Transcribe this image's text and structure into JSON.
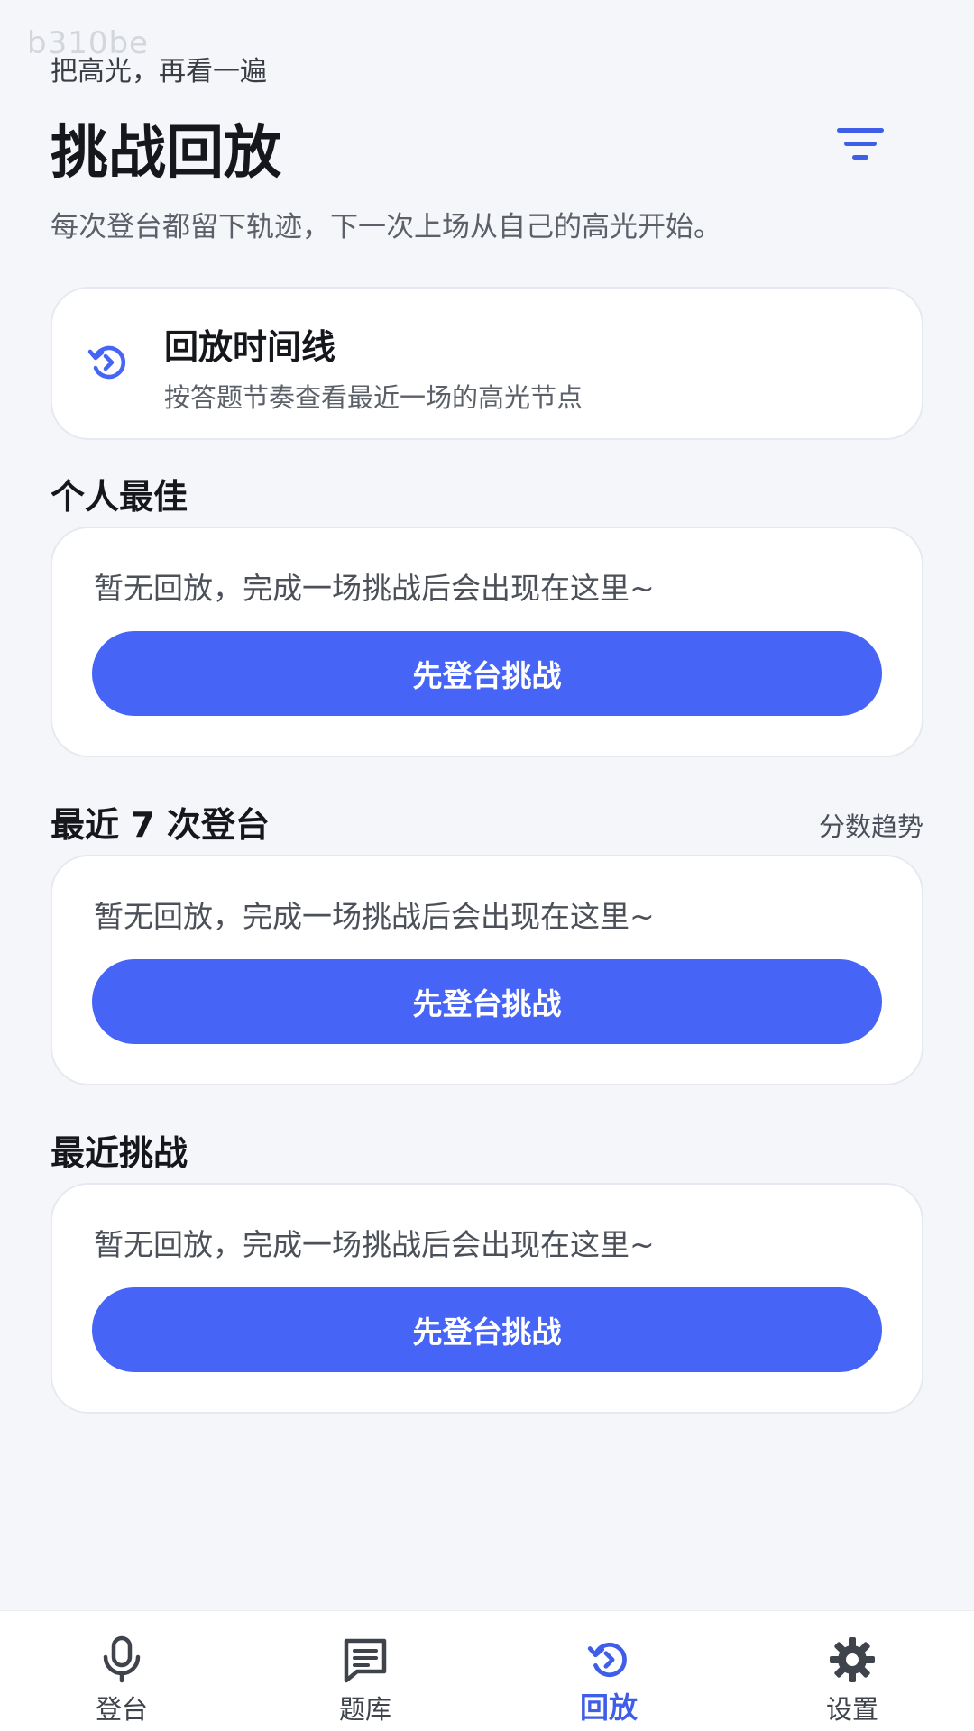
{
  "watermark": "b310be",
  "header": {
    "kicker": "把高光，再看一遍",
    "title": "挑战回放",
    "subtitle": "每次登台都留下轨迹，下一次上场从自己的高光开始。"
  },
  "timeline": {
    "title": "回放时间线",
    "description": "按答题节奏查看最近一场的高光节点"
  },
  "sections": [
    {
      "title": "个人最佳",
      "link": "",
      "empty_text": "暂无回放，完成一场挑战后会出现在这里~",
      "cta_label": "先登台挑战"
    },
    {
      "title": "最近 7 次登台",
      "link": "分数趋势",
      "empty_text": "暂无回放，完成一场挑战后会出现在这里~",
      "cta_label": "先登台挑战"
    },
    {
      "title": "最近挑战",
      "link": "",
      "empty_text": "暂无回放，完成一场挑战后会出现在这里~",
      "cta_label": "先登台挑战"
    }
  ],
  "tabbar": {
    "items": [
      {
        "label": "登台",
        "icon": "microphone-icon"
      },
      {
        "label": "题库",
        "icon": "question-bank-icon"
      },
      {
        "label": "回放",
        "icon": "replay-icon"
      },
      {
        "label": "设置",
        "icon": "gear-icon"
      }
    ],
    "active": "回放"
  },
  "colors": {
    "accent": "#4665f7",
    "background": "#f4f6fa",
    "card": "#ffffff",
    "active_tab": "#3f5ee8"
  }
}
